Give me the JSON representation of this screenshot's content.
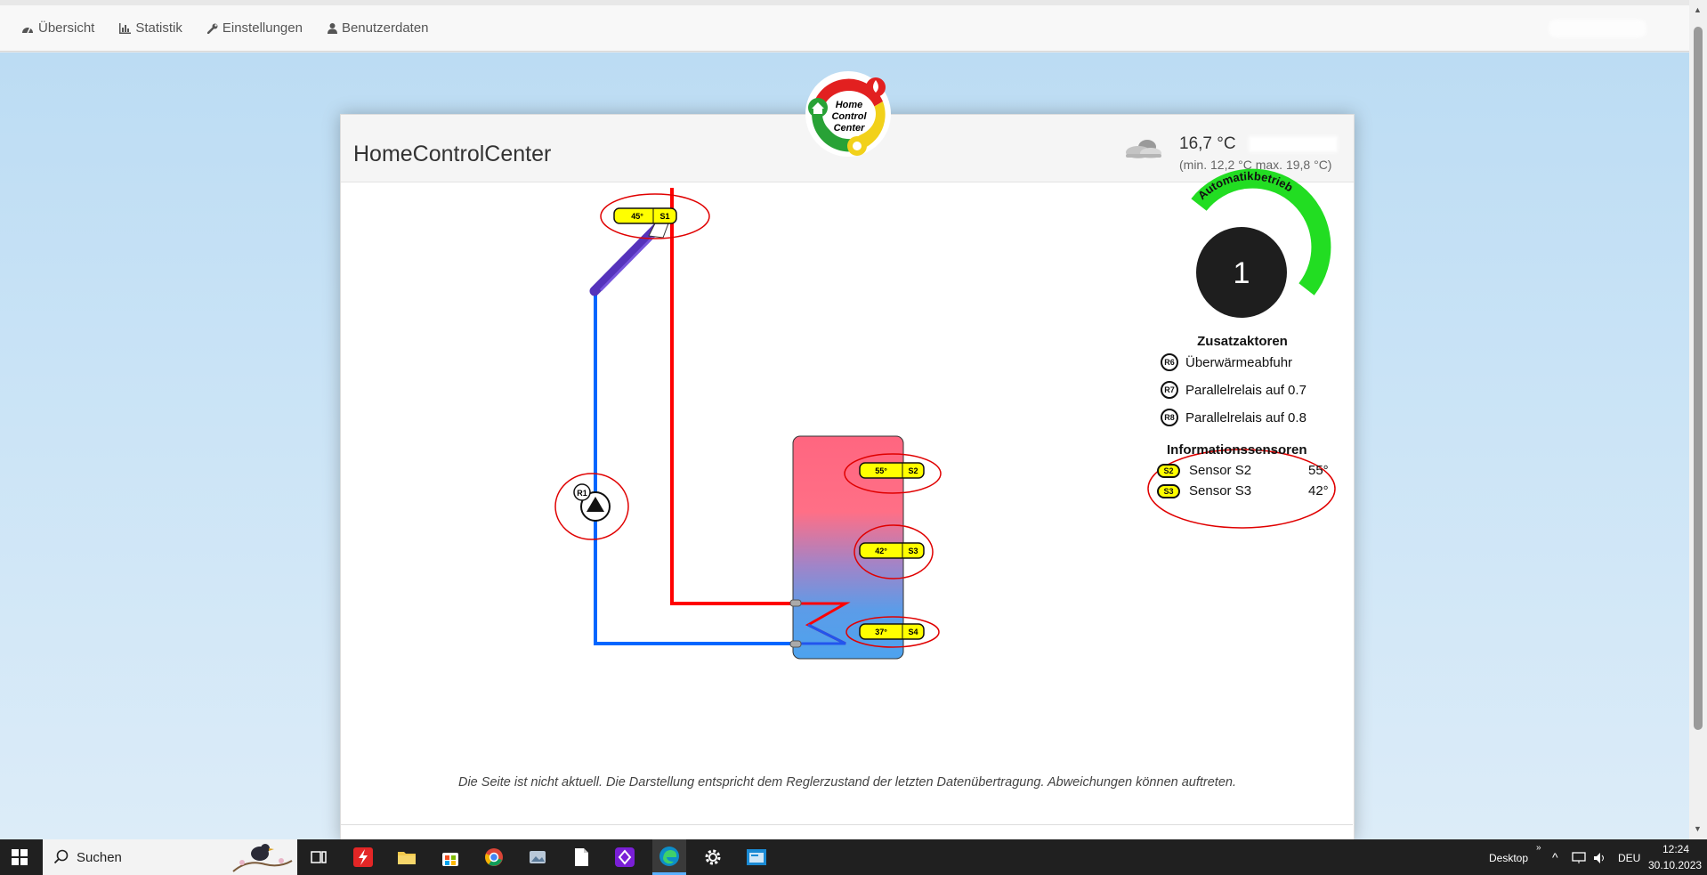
{
  "nav": {
    "items": [
      {
        "label": "Übersicht",
        "icon": "dashboard-icon"
      },
      {
        "label": "Statistik",
        "icon": "bar-chart-icon"
      },
      {
        "label": "Einstellungen",
        "icon": "wrench-icon"
      },
      {
        "label": "Benutzerdaten",
        "icon": "user-icon"
      }
    ]
  },
  "logo": {
    "line1": "Home",
    "line2": "Control",
    "line3": "Center"
  },
  "header": {
    "title": "HomeControlCenter",
    "weather": {
      "icon": "cloud-icon",
      "temperature": "16,7 °C",
      "range": "(min. 12,2 °C  max. 19,8 °C)"
    }
  },
  "diagram": {
    "collector_sensor": {
      "value": "45°",
      "id": "S1"
    },
    "pump": {
      "id": "R1"
    },
    "tank_sensors": [
      {
        "value": "55°",
        "id": "S2"
      },
      {
        "value": "42°",
        "id": "S3"
      },
      {
        "value": "37°",
        "id": "S4"
      }
    ],
    "colors": {
      "hot": "#ff0000",
      "cold": "#0066ff",
      "sensor": "#ffff00",
      "mode": "#22dd22",
      "annotation": "#e00000"
    }
  },
  "mode": {
    "label": "Automatikbetrieb",
    "number": "1"
  },
  "zusatzaktoren": {
    "title": "Zusatzaktoren",
    "items": [
      {
        "id": "R6",
        "label": "Überwärmeabfuhr"
      },
      {
        "id": "R7",
        "label": "Parallelrelais auf 0.7"
      },
      {
        "id": "R8",
        "label": "Parallelrelais auf 0.8"
      }
    ]
  },
  "informationssensoren": {
    "title": "Informationssensoren",
    "items": [
      {
        "id": "S2",
        "label": "Sensor S2",
        "value": "55°"
      },
      {
        "id": "S3",
        "label": "Sensor S3",
        "value": "42°"
      }
    ]
  },
  "footer_note": "Die Seite ist nicht aktuell. Die Darstellung entspricht dem Reglerzustand der letzten Datenübertragung. Abweichungen können auftreten.",
  "taskbar": {
    "search_label": "Suchen",
    "desktop_label": "Desktop",
    "language": "DEU",
    "time": "12:24",
    "date": "30.10.2023"
  }
}
